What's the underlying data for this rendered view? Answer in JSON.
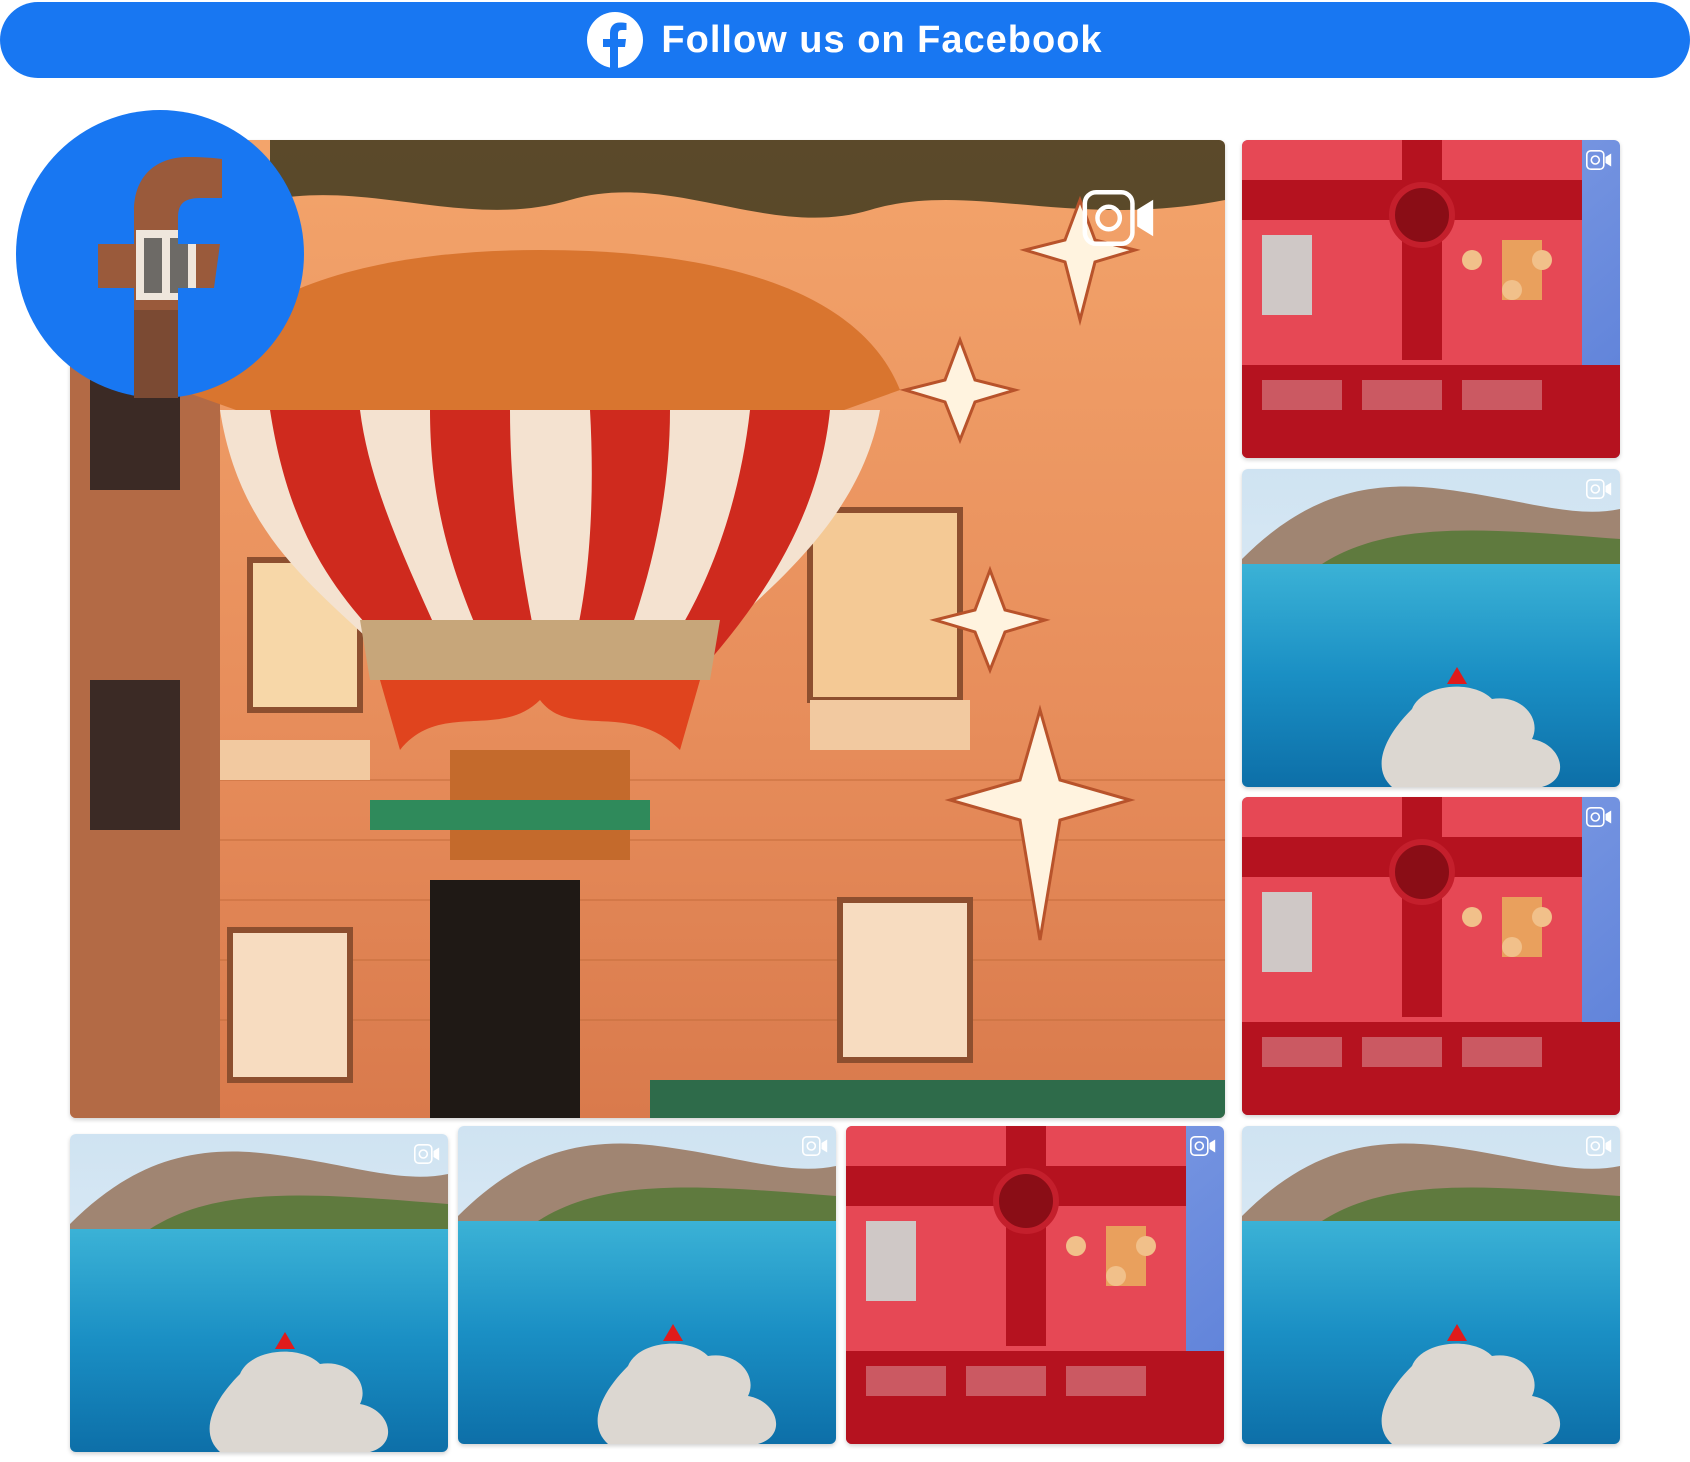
{
  "follow_bar": {
    "label": "Follow us on Facebook",
    "icon": "facebook-icon",
    "color": "#1877f2"
  },
  "badge": {
    "icon": "facebook-icon",
    "color": "#1877f2"
  },
  "feed": {
    "posts": [
      {
        "subject": "hot-air-balloon-facade",
        "media": "video",
        "icon": "video-camera-icon"
      },
      {
        "subject": "cartier-facade",
        "media": "video",
        "icon": "video-camera-icon"
      },
      {
        "subject": "coastline-red-dress",
        "media": "video",
        "icon": "video-camera-icon"
      },
      {
        "subject": "cartier-facade",
        "media": "video",
        "icon": "video-camera-icon"
      },
      {
        "subject": "coastline-red-dress",
        "media": "video",
        "icon": "video-camera-icon"
      },
      {
        "subject": "coastline-red-dress",
        "media": "video",
        "icon": "video-camera-icon"
      },
      {
        "subject": "cartier-facade",
        "media": "video",
        "icon": "video-camera-icon"
      },
      {
        "subject": "coastline-red-dress",
        "media": "video",
        "icon": "video-camera-icon"
      }
    ]
  }
}
